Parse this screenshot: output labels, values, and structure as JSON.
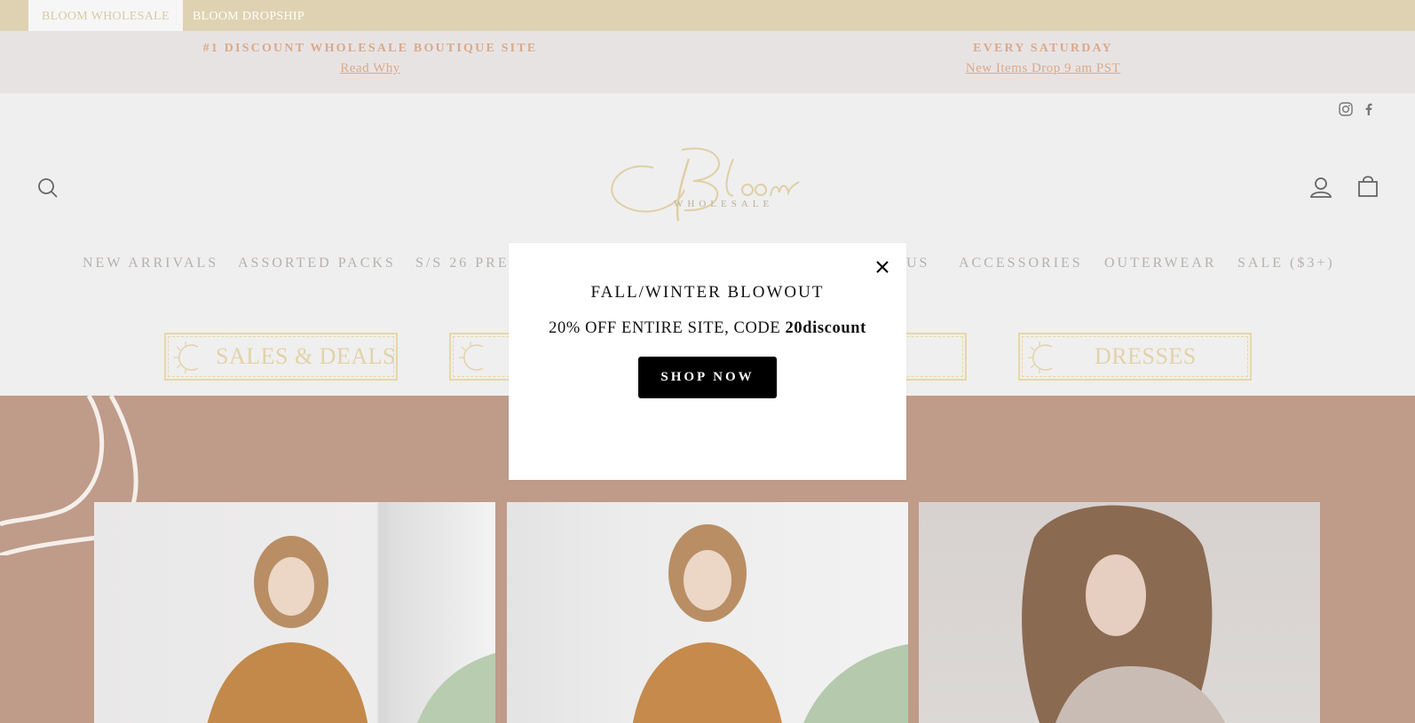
{
  "store_bar": {
    "tabs": [
      {
        "label": "BLOOM WHOLESALE",
        "active": true
      },
      {
        "label": "BLOOM DROPSHIP",
        "active": false
      }
    ]
  },
  "announcements": [
    {
      "title": "#1 DISCOUNT WHOLESALE BOUTIQUE SITE",
      "link": "Read Why"
    },
    {
      "title": "EVERY SATURDAY",
      "link": "New Items Drop 9 am PST"
    }
  ],
  "header": {
    "social": [
      "instagram-icon",
      "facebook-icon"
    ],
    "logo_alt": "Bloom Wholesale",
    "icons": [
      "search-icon",
      "account-icon",
      "cart-icon"
    ]
  },
  "nav": {
    "items": [
      "NEW ARRIVALS",
      "ASSORTED PACKS",
      "S/S 26 PRE",
      "US",
      "ACCESSORIES",
      "OUTERWEAR",
      "SALE ($3+)"
    ]
  },
  "categories": [
    {
      "label": "SALES & DEALS"
    },
    {
      "label": ""
    },
    {
      "label": ""
    },
    {
      "label": "DRESSES"
    }
  ],
  "modal": {
    "title": "FALL/WINTER BLOWOUT",
    "subtitle_prefix": "20% OFF ENTIRE SITE, CODE",
    "code": "20discount",
    "button": "SHOP NOW"
  },
  "colors": {
    "store_bar": "#dfd2b2",
    "announce_text": "#d9a98a",
    "hero_bg": "#bf9b89",
    "gold": "#e2d2a8"
  }
}
